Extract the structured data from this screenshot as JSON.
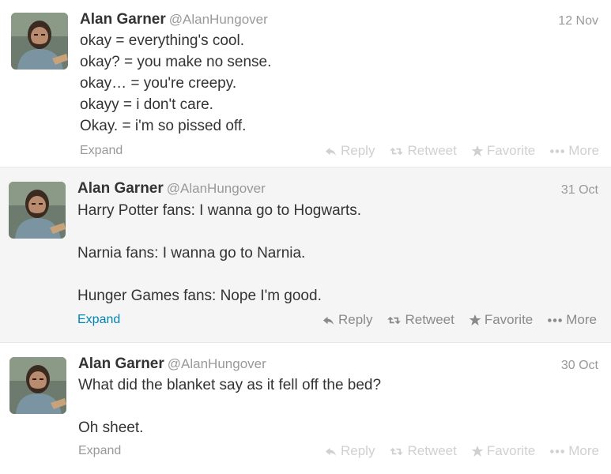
{
  "tweets": [
    {
      "name": "Alan Garner",
      "handle": "@AlanHungover",
      "time": "12 Nov",
      "text": "okay = everything's cool.\nokay? = you make no sense.\nokay… = you're creepy.\nokayy = i don't care.\nOkay. = i'm so pissed off.",
      "expand": "Expand",
      "reply": "Reply",
      "retweet": "Retweet",
      "favorite": "Favorite",
      "more": "More"
    },
    {
      "name": "Alan Garner",
      "handle": "@AlanHungover",
      "time": "31 Oct",
      "text": "Harry Potter fans: I wanna go to Hogwarts.\n\nNarnia fans: I wanna go to Narnia.\n\nHunger Games fans: Nope I'm good.",
      "expand": "Expand",
      "reply": "Reply",
      "retweet": "Retweet",
      "favorite": "Favorite",
      "more": "More"
    },
    {
      "name": "Alan Garner",
      "handle": "@AlanHungover",
      "time": "30 Oct",
      "text": "What did the blanket say as it fell off the bed?\n\nOh sheet.",
      "expand": "Expand",
      "reply": "Reply",
      "retweet": "Retweet",
      "favorite": "Favorite",
      "more": "More"
    }
  ],
  "colors": {
    "link": "#0084b4",
    "highlight_bg": "#f5f5f5",
    "muted": "#999999"
  }
}
